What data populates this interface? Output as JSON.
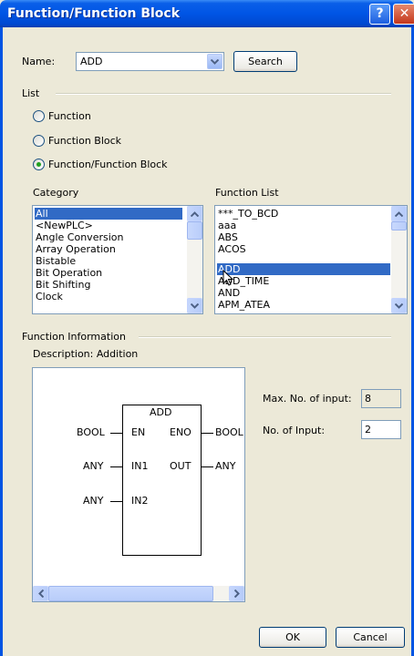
{
  "window": {
    "title": "Function/Function Block"
  },
  "name_row": {
    "label": "Name:",
    "value": "ADD",
    "search_label": "Search"
  },
  "list_group": {
    "label": "List",
    "options": [
      {
        "label": "Function",
        "selected": false
      },
      {
        "label": "Function Block",
        "selected": false
      },
      {
        "label": "Function/Function Block",
        "selected": true
      }
    ]
  },
  "category": {
    "label": "Category",
    "items": [
      "All",
      "<NewPLC>",
      "Angle Conversion",
      "Array Operation",
      "Bistable",
      "Bit Operation",
      "Bit Shifting",
      "Clock"
    ],
    "selected": "All"
  },
  "function_list": {
    "label": "Function List",
    "items": [
      "***_TO_BCD",
      "aaa",
      "ABS",
      "ACOS",
      "ADD",
      "ADD_TIME",
      "AND",
      "APM_ATEA"
    ],
    "selected": "ADD"
  },
  "function_info": {
    "label": "Function Information",
    "description": "Description:  Addition",
    "block": {
      "name": "ADD",
      "inputs": [
        {
          "type": "BOOL",
          "pin": "EN"
        },
        {
          "type": "ANY",
          "pin": "IN1"
        },
        {
          "type": "ANY",
          "pin": "IN2"
        }
      ],
      "outputs": [
        {
          "pin": "ENO",
          "type": "BOOL"
        },
        {
          "pin": "OUT",
          "type": "ANY"
        }
      ]
    },
    "max_inputs_label": "Max. No. of input:",
    "max_inputs_value": "8",
    "num_inputs_label": "No. of Input:",
    "num_inputs_value": "2"
  },
  "buttons": {
    "ok": "OK",
    "cancel": "Cancel"
  },
  "icons": {
    "help": "help-icon",
    "close": "close-icon",
    "dropdown": "chevron-down-icon",
    "scroll_up": "arrow-up-icon",
    "scroll_down": "arrow-down-icon",
    "scroll_left": "arrow-left-icon",
    "scroll_right": "arrow-right-icon",
    "cursor": "mouse-pointer-icon"
  },
  "colors": {
    "title_bar": "#0055e5",
    "selection": "#316ac5",
    "dialog_bg": "#ece9d8",
    "radio_dot": "#21a121"
  }
}
